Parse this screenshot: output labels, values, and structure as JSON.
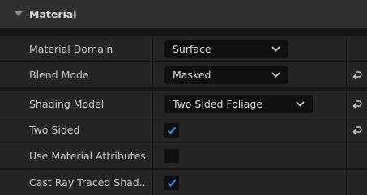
{
  "section": {
    "title": "Material"
  },
  "rows": [
    {
      "label": "Material Domain",
      "value": "Surface"
    },
    {
      "label": "Blend Mode",
      "value": "Masked"
    },
    {
      "label": "Shading Model",
      "value": "Two Sided Foliage"
    },
    {
      "label": "Two Sided",
      "checked": true
    },
    {
      "label": "Use Material Attributes",
      "checked": false
    },
    {
      "label": "Cast Ray Traced Shad...",
      "checked": true
    }
  ],
  "icons": {
    "collapse": "collapse-triangle-icon",
    "dropdown": "chevron-down-icon",
    "reset": "reset-to-default-icon",
    "check": "checkmark-icon"
  },
  "colors": {
    "background": "#151515",
    "row": "#242424",
    "header": "#2f2f2f",
    "field": "#0f0f0f",
    "check_accent": "#2f8fe8"
  }
}
